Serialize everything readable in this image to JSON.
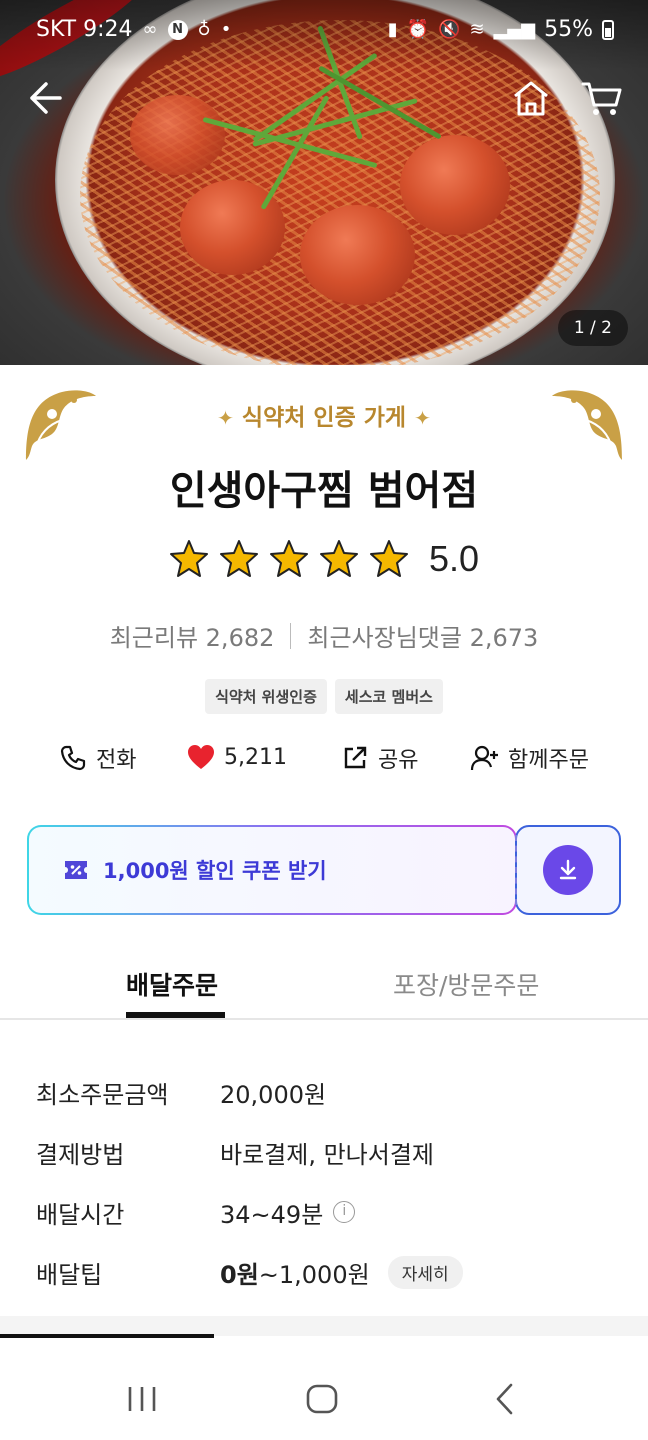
{
  "status_bar": {
    "carrier_time": "SKT 9:24",
    "battery": "55%"
  },
  "hero": {
    "page_counter": "1 / 2"
  },
  "store": {
    "certification": "식약처 인증 가게",
    "name": "인생아구찜 범어점",
    "rating": "5.0",
    "stars": 5,
    "recent_reviews": "최근리뷰 2,682",
    "owner_replies": "최근사장님댓글 2,673",
    "badges": [
      "식약처 위생인증",
      "세스코 멤버스"
    ]
  },
  "actions": {
    "call": "전화",
    "likes": "5,211",
    "share": "공유",
    "group_order": "함께주문"
  },
  "coupon": {
    "label": "1,000원 할인 쿠폰 받기"
  },
  "tabs": {
    "delivery": "배달주문",
    "pickup": "포장/방문주문"
  },
  "info": {
    "min_order_label": "최소주문금액",
    "min_order_value": "20,000원",
    "payment_label": "결제방법",
    "payment_value": "바로결제, 만나서결제",
    "time_label": "배달시간",
    "time_value": "34~49분",
    "tip_label": "배달팁",
    "tip_min": "0원",
    "tip_rest": "~1,000원",
    "detail_button": "자세히"
  },
  "colors": {
    "accent_purple": "#6a48e8",
    "coupon_text": "#3d3ad6",
    "heart": "#e8232e",
    "gold": "#b8872e",
    "star": "#f5b800"
  }
}
